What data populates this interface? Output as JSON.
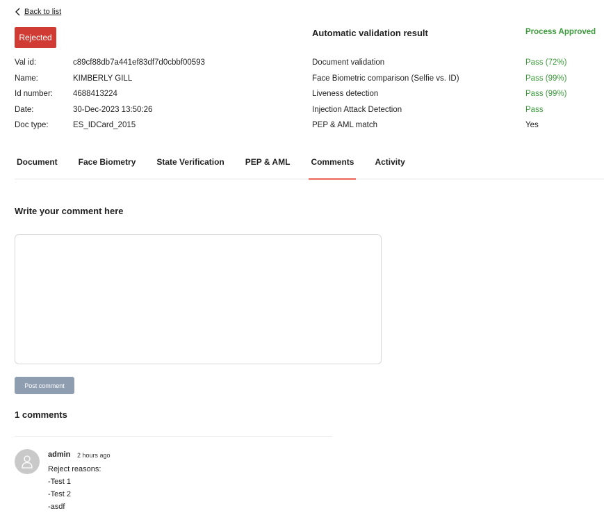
{
  "nav": {
    "back_label": "Back to list"
  },
  "status_badge": "Rejected",
  "info": [
    {
      "label": "Val id:",
      "value": "c89cf88db7a441ef83df7d0cbbf00593"
    },
    {
      "label": "Name:",
      "value": "KIMBERLY GILL"
    },
    {
      "label": "Id number:",
      "value": "4688413224"
    },
    {
      "label": "Date:",
      "value": "30-Dec-2023 13:50:26"
    },
    {
      "label": "Doc type:",
      "value": "ES_IDCard_2015"
    }
  ],
  "auto_validation": {
    "title": "Automatic validation result",
    "status": "Process Approved",
    "checks": [
      {
        "label": "Document validation",
        "value": "Pass (72%)"
      },
      {
        "label": "Face Biometric comparison (Selfie vs. ID)",
        "value": "Pass (99%)"
      },
      {
        "label": "Liveness detection",
        "value": "Pass (99%)"
      },
      {
        "label": "Injection Attack Detection",
        "value": "Pass"
      },
      {
        "label": "PEP & AML match",
        "value": "Yes"
      }
    ]
  },
  "tabs": [
    {
      "label": "Document"
    },
    {
      "label": "Face Biometry"
    },
    {
      "label": "State Verification"
    },
    {
      "label": "PEP & AML"
    },
    {
      "label": "Comments"
    },
    {
      "label": "Activity"
    }
  ],
  "comment_form": {
    "title": "Write your comment here",
    "value": "",
    "post_label": "Post comment"
  },
  "comments": {
    "count_label": "1 comments",
    "items": [
      {
        "author": "admin",
        "time": "2 hours ago",
        "lines": [
          "Reject reasons:",
          "-Test 1",
          "-Test 2",
          "-asdf"
        ]
      }
    ]
  },
  "colors": {
    "rejected_badge": "#d03c33",
    "pass_text": "#3b9b3b",
    "active_tab_underline": "#f0857c",
    "post_button": "#8f9db0"
  },
  "icons": {
    "back": "chevron-left-icon",
    "avatar": "user-icon"
  }
}
